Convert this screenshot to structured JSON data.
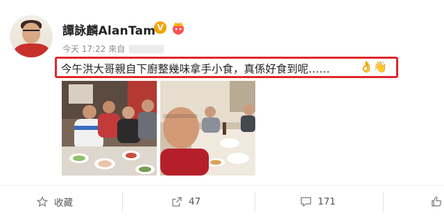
{
  "post": {
    "author": "譚詠麟AlanTam",
    "verified_badge": "V",
    "time": "今天 17:22",
    "source_prefix": "來自",
    "text": "今午洪大哥親自下廚整幾味拿手小食，真係好食到呢……",
    "emoji": [
      "👌",
      "👋"
    ]
  },
  "actions": {
    "bookmark_label": "收藏",
    "repost_count": "47",
    "comment_count": "171"
  },
  "icons": [
    "star-icon",
    "repost-icon",
    "comment-icon",
    "like-icon",
    "crown-icon"
  ],
  "colors": {
    "highlight_border": "#e0262b",
    "verified": "#f5a100",
    "meta_text": "#8a8a8a"
  }
}
